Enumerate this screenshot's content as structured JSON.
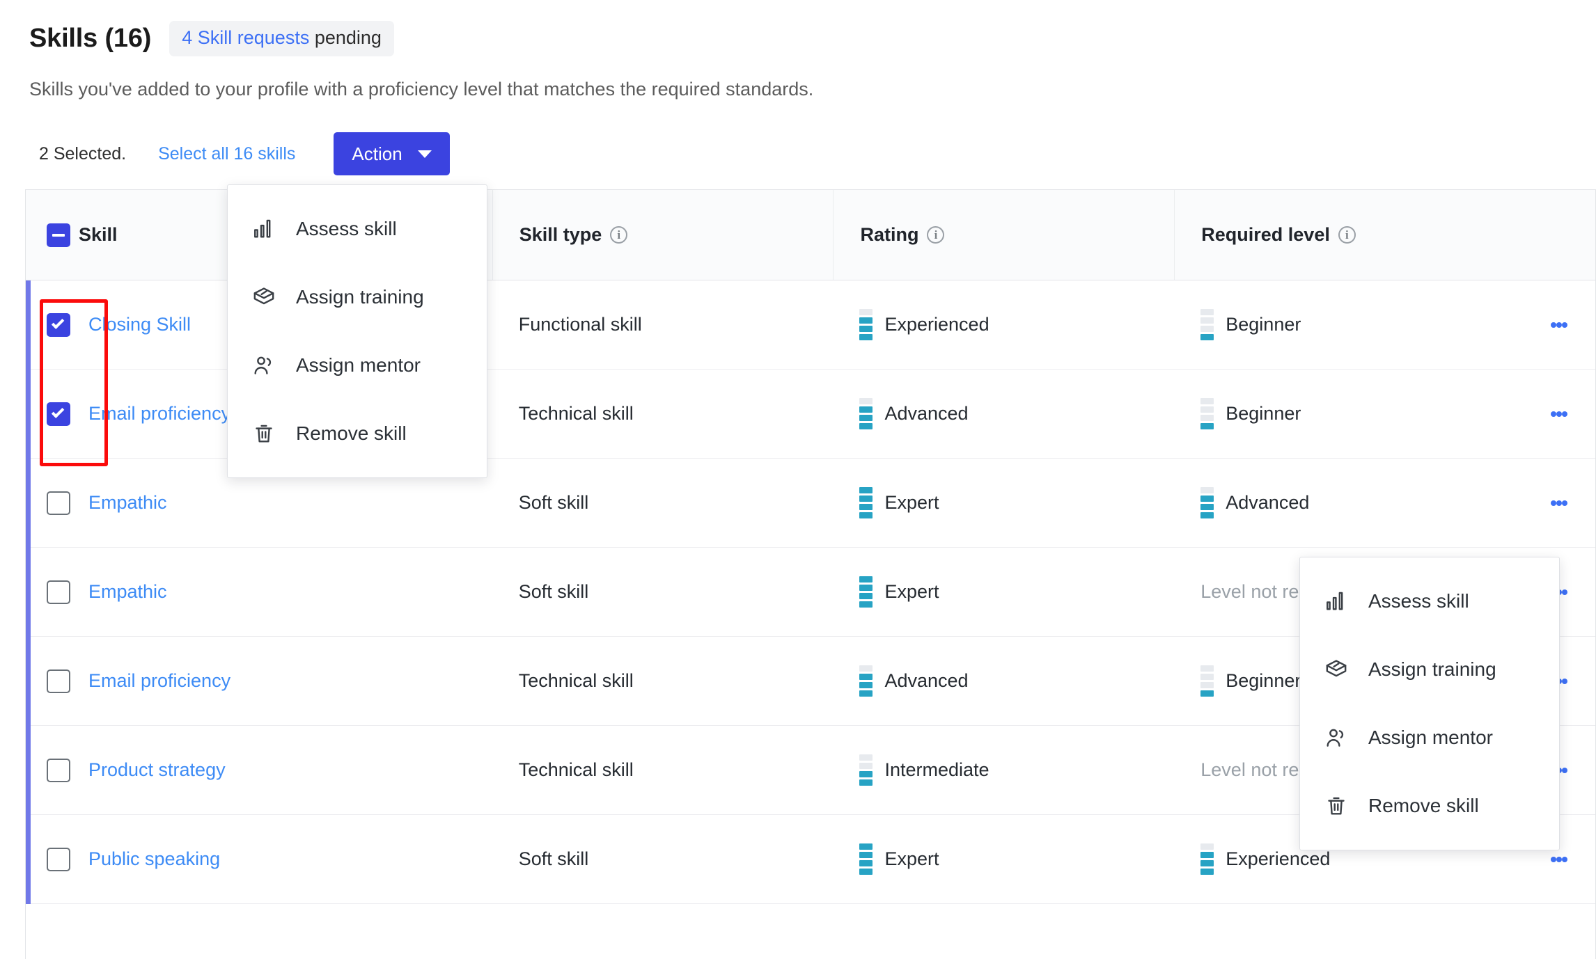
{
  "header": {
    "title": "Skills (16)",
    "pending_link": "4 Skill requests",
    "pending_suffix": " pending",
    "subtitle": "Skills you've added to your profile with a proficiency level that matches the required standards."
  },
  "toolbar": {
    "selected_text": "2 Selected.",
    "select_all_label": "Select all 16 skills",
    "action_label": "Action",
    "caret_icon": "chevron-down-icon"
  },
  "table": {
    "columns": [
      {
        "label": "Skill",
        "has_info": false
      },
      {
        "label": "Skill type",
        "has_info": true
      },
      {
        "label": "Rating",
        "has_info": true
      },
      {
        "label": "Required level",
        "has_info": true
      }
    ],
    "info_glyph": "i",
    "header_checkbox_state": "indeterminate",
    "rows": [
      {
        "skill": "Closing Skill",
        "checked": true,
        "type": "Functional skill",
        "rating": {
          "label": "Experienced",
          "filled": 3,
          "total": 4
        },
        "required": {
          "label": "Beginner",
          "filled": 1,
          "total": 4,
          "muted": false
        }
      },
      {
        "skill": "Email proficiency",
        "checked": true,
        "type": "Technical skill",
        "rating": {
          "label": "Advanced",
          "filled": 3,
          "total": 4
        },
        "required": {
          "label": "Beginner",
          "filled": 1,
          "total": 4,
          "muted": false
        }
      },
      {
        "skill": "Empathic",
        "checked": false,
        "type": "Soft skill",
        "rating": {
          "label": "Expert",
          "filled": 4,
          "total": 4
        },
        "required": {
          "label": "Advanced",
          "filled": 3,
          "total": 4,
          "muted": false
        }
      },
      {
        "skill": "Empathic",
        "checked": false,
        "type": "Soft skill",
        "rating": {
          "label": "Expert",
          "filled": 4,
          "total": 4
        },
        "required": {
          "label": "Level not required",
          "filled": 0,
          "total": 0,
          "muted": true
        }
      },
      {
        "skill": "Email proficiency",
        "checked": false,
        "type": "Technical skill",
        "rating": {
          "label": "Advanced",
          "filled": 3,
          "total": 4
        },
        "required": {
          "label": "Beginner",
          "filled": 1,
          "total": 4,
          "muted": false
        }
      },
      {
        "skill": "Product strategy",
        "checked": false,
        "type": "Technical skill",
        "rating": {
          "label": "Intermediate",
          "filled": 2,
          "total": 4
        },
        "required": {
          "label": "Level not required",
          "filled": 0,
          "total": 0,
          "muted": true
        }
      },
      {
        "skill": "Public speaking",
        "checked": false,
        "type": "Soft skill",
        "rating": {
          "label": "Expert",
          "filled": 4,
          "total": 4
        },
        "required": {
          "label": "Experienced",
          "filled": 3,
          "total": 4,
          "muted": false
        }
      }
    ],
    "row_menu_icon": "kebab-menu-icon"
  },
  "action_menu": {
    "items": [
      {
        "label": "Assess skill",
        "icon": "bar-chart-icon"
      },
      {
        "label": "Assign training",
        "icon": "graduation-cap-icon"
      },
      {
        "label": "Assign mentor",
        "icon": "people-icon"
      },
      {
        "label": "Remove skill",
        "icon": "trash-icon"
      }
    ]
  },
  "row_menu": {
    "items": [
      {
        "label": "Assess skill",
        "icon": "bar-chart-icon"
      },
      {
        "label": "Assign training",
        "icon": "graduation-cap-icon"
      },
      {
        "label": "Assign mentor",
        "icon": "people-icon"
      },
      {
        "label": "Remove skill",
        "icon": "trash-icon"
      }
    ]
  },
  "annotation": {
    "type": "red-highlight-box",
    "target": "selected-row-checkboxes"
  },
  "colors": {
    "accent_blue": "#3b43e0",
    "link_blue": "#3d8bf5",
    "level_teal": "#27a3c4",
    "level_empty": "#e7eaee",
    "annotation_red": "#fb0b0b",
    "row_accent": "#7078e8"
  }
}
